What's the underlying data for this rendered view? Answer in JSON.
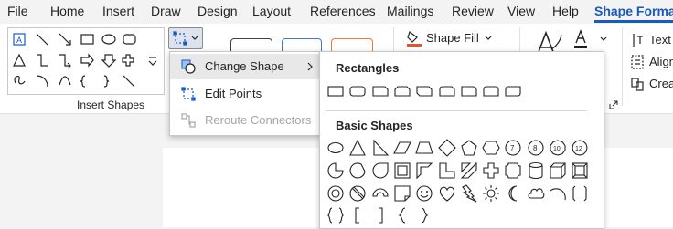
{
  "tabs": [
    {
      "label": "File"
    },
    {
      "label": "Home"
    },
    {
      "label": "Insert"
    },
    {
      "label": "Draw"
    },
    {
      "label": "Design"
    },
    {
      "label": "Layout"
    },
    {
      "label": "References"
    },
    {
      "label": "Mailings"
    },
    {
      "label": "Review"
    },
    {
      "label": "View"
    },
    {
      "label": "Help"
    },
    {
      "label": "Shape Format"
    }
  ],
  "ribbon": {
    "insert_shapes_label": "Insert Shapes",
    "shape_fill_label": "Shape Fill",
    "text_label": "Text",
    "align_label": "Align",
    "create_label": "Crea"
  },
  "edit_shape_menu": {
    "items": [
      {
        "label": "Change Shape",
        "icon": "change-shape-icon",
        "has_submenu": true
      },
      {
        "label": "Edit Points",
        "icon": "edit-points-icon"
      },
      {
        "label": "Reroute Connectors",
        "icon": "reroute-connectors-icon",
        "disabled": true
      }
    ]
  },
  "change_shape_submenu": {
    "sections": [
      {
        "heading": "Rectangles"
      },
      {
        "heading": "Basic Shapes"
      }
    ]
  },
  "colors": {
    "accent": "#185abd",
    "menu_hover": "#e8e8e8",
    "disabled_text": "#a6a6a6"
  }
}
